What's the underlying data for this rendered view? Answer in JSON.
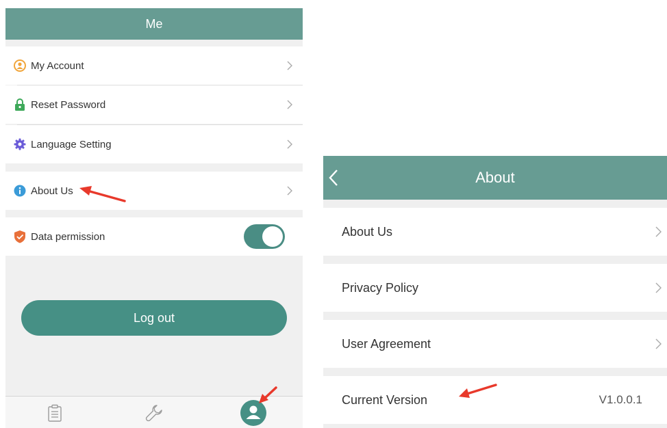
{
  "left": {
    "header_title": "Me",
    "menu": [
      {
        "label": "My Account",
        "icon": "user-circle-icon"
      },
      {
        "label": "Reset Password",
        "icon": "lock-icon"
      },
      {
        "label": "Language Setting",
        "icon": "gear-icon"
      },
      {
        "label": "About Us",
        "icon": "info-icon"
      },
      {
        "label": "Data permission",
        "icon": "shield-check-icon"
      }
    ],
    "data_permission_on": true,
    "logout_label": "Log out",
    "tabs": [
      {
        "icon": "clipboard-icon"
      },
      {
        "icon": "wrench-icon"
      },
      {
        "icon": "profile-icon",
        "active": true
      }
    ]
  },
  "right": {
    "header_title": "About",
    "rows": [
      {
        "label": "About Us"
      },
      {
        "label": "Privacy Policy"
      },
      {
        "label": "User Agreement"
      },
      {
        "label": "Current Version",
        "value": "V1.0.0.1"
      }
    ]
  },
  "colors": {
    "header": "#679c93",
    "accent": "#469085",
    "annotation_arrow": "#e8392b"
  }
}
